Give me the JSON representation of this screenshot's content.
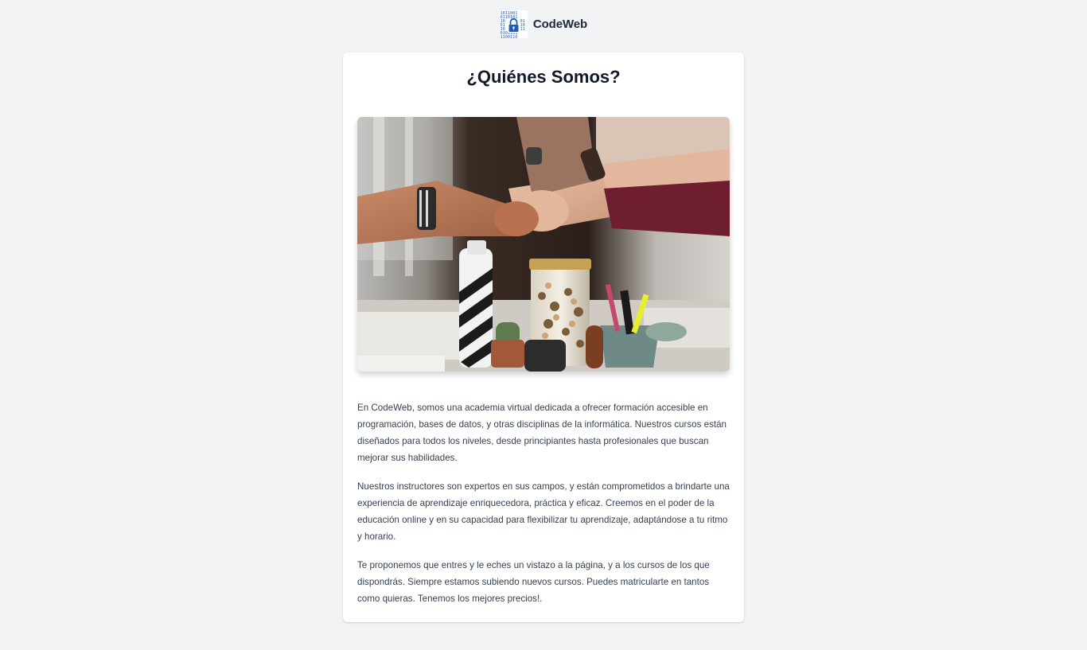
{
  "header": {
    "brand": "CodeWeb",
    "logo_icon": "binary-lock-icon",
    "logo_color": "#1d5fb8"
  },
  "about": {
    "title": "¿Quiénes Somos?",
    "image_icon": "team-fist-bump-photo",
    "paragraphs": [
      "En CodeWeb, somos una academia virtual dedicada a ofrecer formación accesible en programación, bases de datos, y otras disciplinas de la informática. Nuestros cursos están diseñados para todos los niveles, desde principiantes hasta profesionales que buscan mejorar sus habilidades.",
      "Nuestros instructores son expertos en sus campos, y están comprometidos a brindarte una experiencia de aprendizaje enriquecedora, práctica y eficaz. Creemos en el poder de la educación online y en su capacidad para flexibilizar tu aprendizaje, adaptándose a tu ritmo y horario.",
      "Te proponemos que entres y le eches un vistazo a la página, y a los cursos de los que dispondrás. Siempre estamos subiendo nuevos cursos. Puedes matricularte en tantos como quieras. Tenemos los mejores precios!."
    ]
  }
}
